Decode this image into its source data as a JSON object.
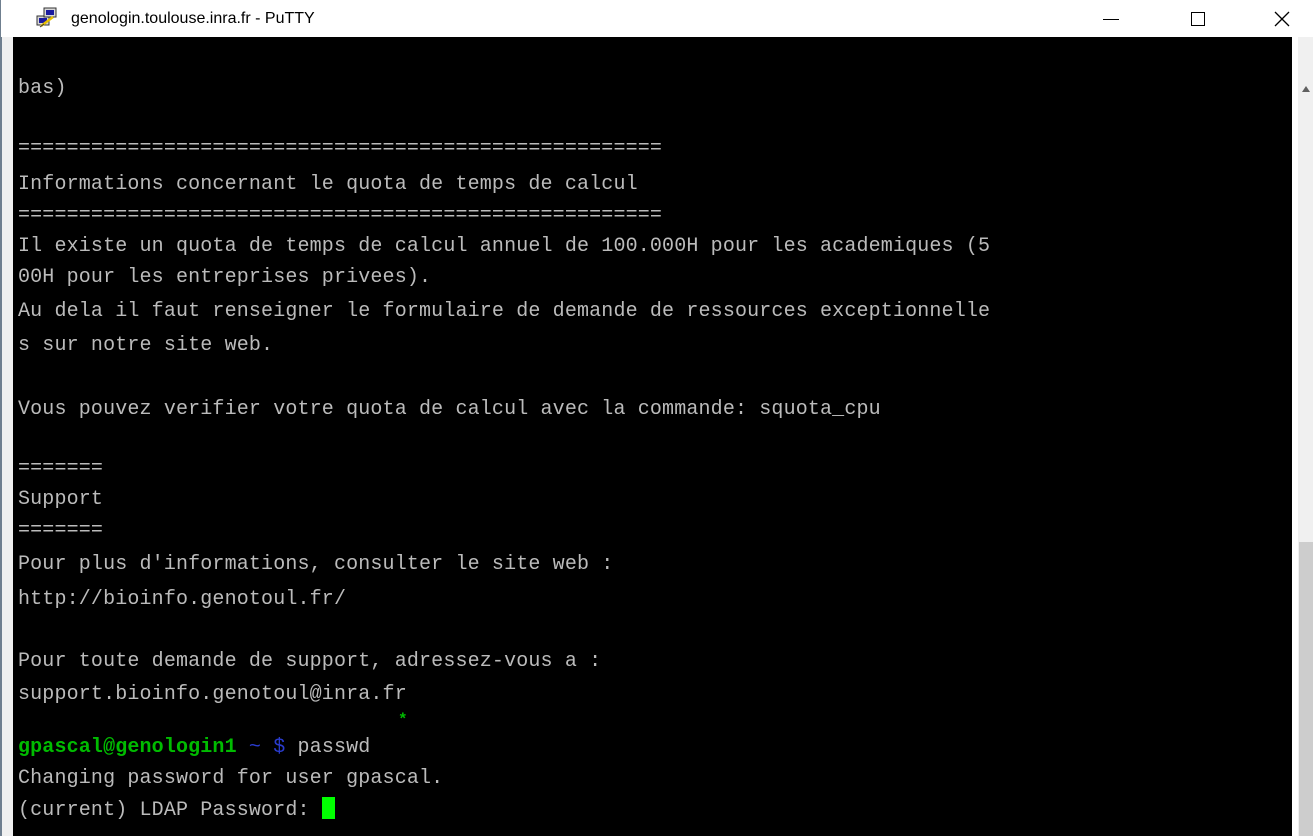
{
  "window": {
    "title": "genologin.toulouse.inra.fr - PuTTY"
  },
  "icons": {
    "app": "putty-icon",
    "minimize": "minimize-icon",
    "maximize": "maximize-icon",
    "close": "close-icon"
  },
  "terminal": {
    "lines": [
      "bas)",
      "",
      "=====================================================",
      "Informations concernant le quota de temps de calcul",
      "=====================================================",
      "Il existe un quota de temps de calcul annuel de 100.000H pour les academiques (5",
      "00H pour les entreprises privees).",
      "Au dela il faut renseigner le formulaire de demande de ressources exceptionnelle",
      "s sur notre site web.",
      "",
      "Vous pouvez verifier votre quota de calcul avec la commande: squota_cpu",
      "",
      "=======",
      "Support",
      "=======",
      "Pour plus d'informations, consulter le site web :",
      "http://bioinfo.genotoul.fr/",
      "",
      "Pour toute demande de support, adressez-vous a :",
      "support.bioinfo.genotoul@inra.fr"
    ],
    "star": "*",
    "prompt": {
      "user_host": "gpascal@genologin1",
      "tilde": "~",
      "dollar": "$",
      "command": "passwd"
    },
    "output1": "Changing password for user gpascal.",
    "output2": "(current) LDAP Password: "
  },
  "colors": {
    "terminal_bg": "#000000",
    "terminal_text": "#bbbbbb",
    "prompt_green": "#00bb00",
    "prompt_blue": "#2a3ccf",
    "cursor": "#00ff00"
  }
}
